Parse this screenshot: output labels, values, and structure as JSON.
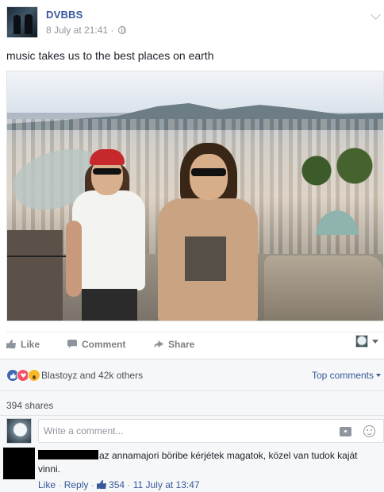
{
  "post": {
    "author": "DVBBS",
    "timestamp": "8 July at 21:41",
    "separator": " · ",
    "audience_icon": "globe-icon",
    "text": "music takes us to the best places on earth"
  },
  "actions": {
    "like": "Like",
    "comment": "Comment",
    "share": "Share"
  },
  "reactions": {
    "icons": [
      "like",
      "love",
      "wow"
    ],
    "summary": "Blastoyz and 42k others",
    "sort_label": "Top comments"
  },
  "shares": "394 shares",
  "composer": {
    "placeholder": "Write a comment..."
  },
  "comment": {
    "text": "az annamajori böribe kérjétek magatok, közel van tudok kaját vinni.",
    "like": "Like",
    "reply": "Reply",
    "likes_count": "354",
    "timestamp": "11 July at 13:47",
    "separator": " · "
  },
  "colors": {
    "link_blue": "#365899",
    "like_blue": "#4267b2",
    "love_red": "#f25268",
    "wow_yellow": "#f7b928",
    "meta_grey": "#90949c"
  }
}
